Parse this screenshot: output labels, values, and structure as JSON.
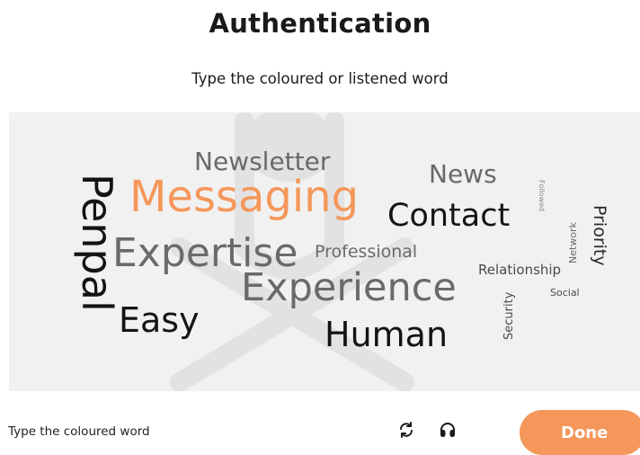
{
  "header": {
    "title": "Authentication",
    "instruction": "Type the coloured or listened word"
  },
  "captcha": {
    "background_color": "#f1f1f1",
    "watermark_color": "#e2e2e2",
    "highlight_color": "#f5975a",
    "words": [
      {
        "text": "Newsletter",
        "color": "#6a6a6a"
      },
      {
        "text": "News",
        "color": "#6a6a6a"
      },
      {
        "text": "Messaging",
        "color": "#f5975a"
      },
      {
        "text": "Contact",
        "color": "#141414"
      },
      {
        "text": "Penpal",
        "color": "#141414"
      },
      {
        "text": "Expertise",
        "color": "#6a6a6a"
      },
      {
        "text": "Professional",
        "color": "#6a6a6a"
      },
      {
        "text": "Experience",
        "color": "#6a6a6a"
      },
      {
        "text": "Easy",
        "color": "#141414"
      },
      {
        "text": "Human",
        "color": "#141414"
      },
      {
        "text": "Relationship",
        "color": "#4a4a4a"
      },
      {
        "text": "Social",
        "color": "#4a4a4a"
      },
      {
        "text": "Security",
        "color": "#4a4a4a"
      },
      {
        "text": "Followed",
        "color": "#8a8a8a"
      },
      {
        "text": "Network",
        "color": "#6a6a6a"
      },
      {
        "text": "Priority",
        "color": "#2a2a2a"
      }
    ]
  },
  "footer": {
    "input_placeholder": "Type the coloured word",
    "refresh_icon": "refresh-icon",
    "audio_icon": "headphones-icon",
    "done_label": "Done",
    "done_color": "#f5975a"
  }
}
